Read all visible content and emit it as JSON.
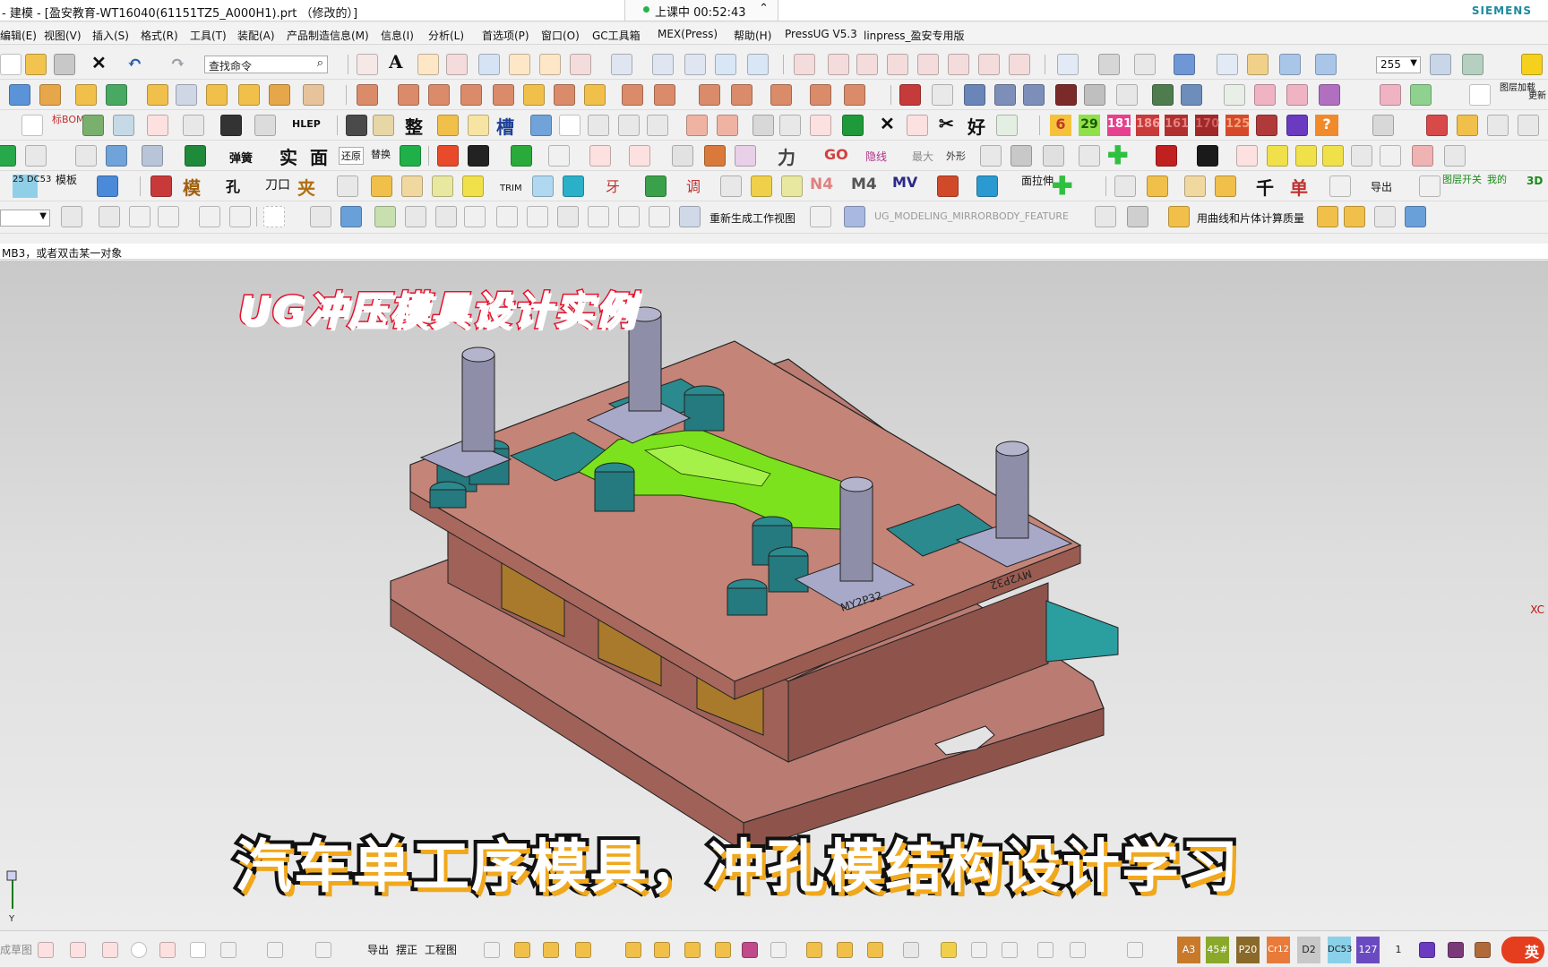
{
  "window": {
    "title": "- 建模 - [盈安教育-WT16040(61151TZ5_A000H1).prt （修改的）]",
    "brand": "SIEMENS"
  },
  "class_timer": {
    "text": "上课中 00:52:43",
    "dot_color": "#27b34a"
  },
  "menu": [
    "编辑(E)",
    "视图(V)",
    "插入(S)",
    "格式(R)",
    "工具(T)",
    "装配(A)",
    "产品制造信息(M)",
    "信息(I)",
    "分析(L)",
    "首选项(P)",
    "窗口(O)",
    "GC工具箱",
    "MEX(Press)",
    "帮助(H)",
    "PressUG V5.3",
    "linpress_盈安专用版"
  ],
  "toolbar": {
    "command_search_value": "查找命令",
    "layer_value": "255",
    "row2": {
      "right_labels": [
        "图层加载",
        "更新"
      ]
    },
    "row3": {
      "labels": [
        "标BOM",
        "HLEP",
        "整",
        "槽",
        "好"
      ],
      "numbered_buttons": [
        "6",
        "29",
        "181",
        "186",
        "161",
        "170",
        "125",
        "?"
      ]
    },
    "row4": {
      "labels": [
        "弹簧",
        "实",
        "面",
        "还原",
        "替换",
        "力",
        "GO",
        "隐线",
        "最大",
        "外形"
      ]
    },
    "row5": {
      "labels": [
        "25 DC53",
        "模板",
        "模",
        "孔",
        "刀口",
        "夹",
        "TRIM",
        "牙",
        "调",
        "N4",
        "M4",
        "MV",
        "面拉伸",
        "千",
        "单",
        "导出",
        "图层开关",
        "我的",
        "3D"
      ]
    },
    "row6": {
      "regen_label": "重新生成工作视图",
      "feature_label": "UG_MODELING_MIRRORBODY_FEATURE",
      "mass_label": "用曲线和片体计算质量"
    }
  },
  "status_prompt": "MB3，或者双击某一对象",
  "viewport": {
    "overlay_title": "UG冲压模具设计实例",
    "overlay_caption": "汽车单工序模具，冲孔模结构设计学习",
    "axis_label": "XC",
    "triad_label": "Y",
    "engraved_labels": [
      "MY2P32",
      "MY2P32"
    ],
    "colors": {
      "base_plate": "#b97b72",
      "pad": "#2b8a8e",
      "part": "#7de21e",
      "pillar": "#8e8ea8",
      "block": "#9b7a2e",
      "title_stroke": "#e8112d",
      "caption_shadow": "#f0a81c"
    }
  },
  "bottom": {
    "faded_label": "成草图",
    "labels": [
      "导出",
      "摆正",
      "工程图"
    ],
    "material_labels": [
      "A3",
      "45#",
      "P20",
      "Cr12",
      "D2",
      "DC53",
      "127",
      "1"
    ],
    "ime_label": "英"
  }
}
